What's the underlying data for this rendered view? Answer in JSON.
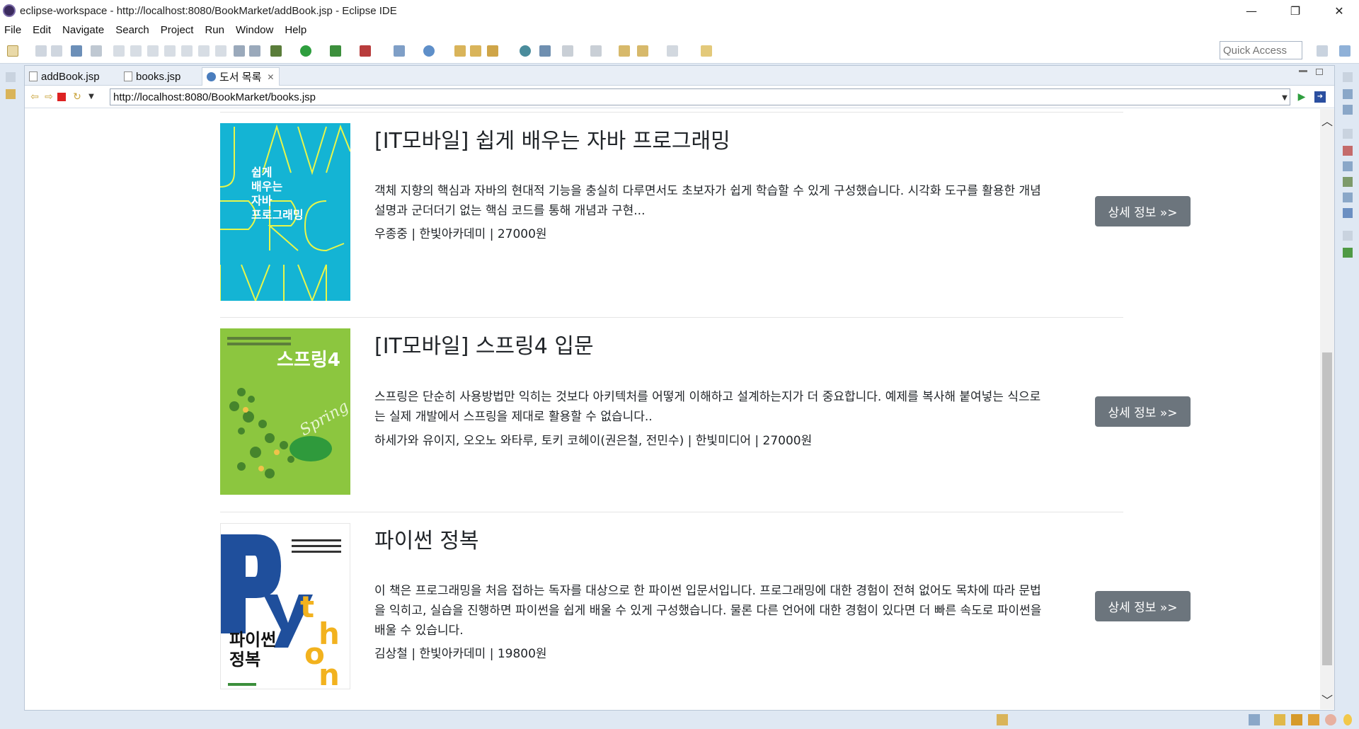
{
  "window": {
    "title": "eclipse-workspace - http://localhost:8080/BookMarket/addBook.jsp - Eclipse IDE",
    "minimize": "—",
    "restore": "❐",
    "close": "✕"
  },
  "menu": [
    "File",
    "Edit",
    "Navigate",
    "Search",
    "Project",
    "Run",
    "Window",
    "Help"
  ],
  "quick_access": {
    "placeholder": "Quick Access"
  },
  "tabs": [
    {
      "label": "addBook.jsp",
      "active": false
    },
    {
      "label": "books.jsp",
      "active": false
    },
    {
      "label": "도서 목록",
      "active": true,
      "close": "✕"
    }
  ],
  "browser": {
    "url": "http://localhost:8080/BookMarket/books.jsp"
  },
  "books": [
    {
      "title": "[IT모바일] 쉽게 배우는 자바 프로그래밍",
      "description": "객체 지향의 핵심과 자바의 현대적 기능을 충실히 다루면서도 초보자가 쉽게 학습할 수 있게 구성했습니다. 시각화 도구를 활용한 개념 설명과 군더더기 없는 핵심 코드를 통해 개념과 구현...",
      "meta": "우종중 | 한빛아카데미 | 27000원",
      "button": "상세 정보 »>",
      "cover_text": "쉽게\n배우는\n자바\n프로그래밍",
      "cover_color": "#14b4d4"
    },
    {
      "title": "[IT모바일] 스프링4 입문",
      "description": "스프링은 단순히 사용방법만 익히는 것보다 아키텍처를 어떻게 이해하고 설계하는지가 더 중요합니다. 예제를 복사해 붙여넣는 식으로는 실제 개발에서 스프링을 제대로 활용할 수 없습니다..",
      "meta": "하세가와 유이지, 오오노 와타루, 토키 코헤이(권은철, 전민수) | 한빛미디어 | 27000원",
      "button": "상세 정보 »>",
      "cover_text": "스프링4",
      "cover_color": "#8cc63f"
    },
    {
      "title": "파이썬 정복",
      "description": "이 책은 프로그래밍을 처음 접하는 독자를 대상으로 한 파이썬 입문서입니다. 프로그래밍에 대한 경험이 전혀 없어도 목차에 따라 문법을 익히고, 실습을 진행하면 파이썬을 쉽게 배울 수 있게 구성했습니다. 물론 다른 언어에 대한 경험이 있다면 더 빠른 속도로 파이썬을 배울 수 있습니다.",
      "meta": "김상철 | 한빛아카데미 | 19800원",
      "button": "상세 정보 »>",
      "cover_text": "파이썬\n정복",
      "cover_color": "#ffffff"
    }
  ]
}
